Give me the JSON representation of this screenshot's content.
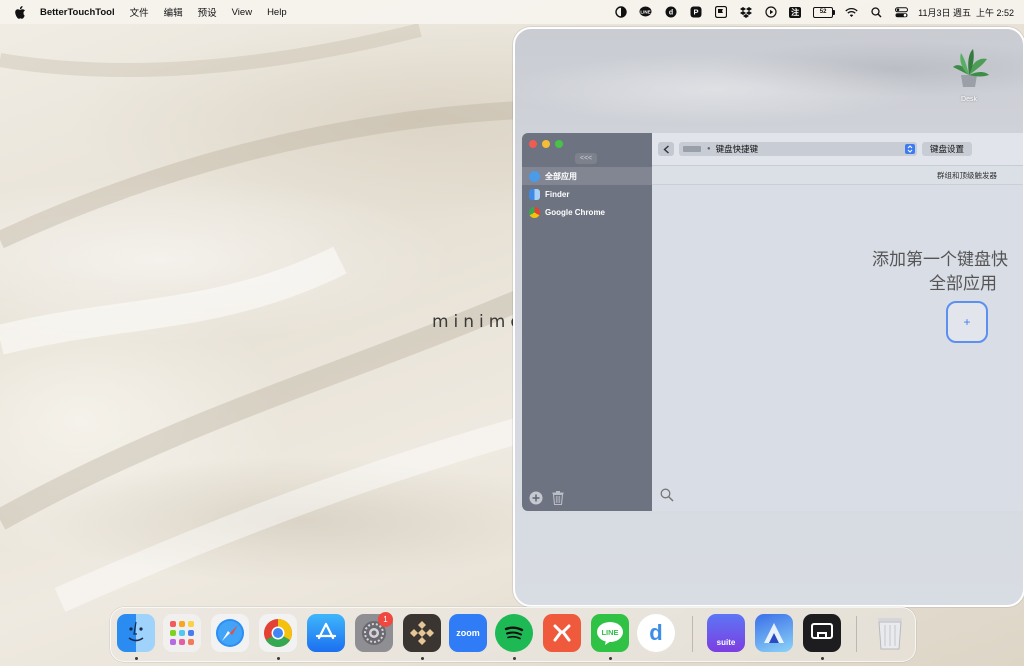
{
  "menubar": {
    "app_name": "BetterTouchTool",
    "menus": [
      "文件",
      "编辑",
      "预设",
      "View",
      "Help"
    ],
    "status_icons": [
      "contrast-icon",
      "line-icon",
      "d-app-icon",
      "p-app-icon",
      "flag-icon",
      "dropbox-icon",
      "play-icon"
    ],
    "input_method": "注",
    "battery": "52",
    "date": "11月3日 週五",
    "time": "上午 2:52"
  },
  "desktop": {
    "wallpaper_text": "minimo",
    "desk_icon_label": "Desk"
  },
  "btt": {
    "collapse_label": "<<<",
    "apps": [
      {
        "label": "全部应用",
        "color": "#4a9be8"
      },
      {
        "label": "Finder",
        "color": "#3f8ae6"
      },
      {
        "label": "Google Chrome",
        "color": "#e9c23a"
      }
    ],
    "trigger_type": "键盘快捷键",
    "settings_label": "键盘设置",
    "subbar_label": "群组和顶级触发器",
    "empty_title": "添加第一个键盘快",
    "empty_subtitle": "全部应用",
    "add_label": "+"
  },
  "dock": {
    "apps": [
      "Finder",
      "Launchpad",
      "Safari",
      "Google Chrome",
      "App Store",
      "System Settings",
      "BetterTouchTool",
      "Zoom",
      "Spotify",
      "Mango",
      "LINE",
      "Dayone",
      "Suite",
      "Artstudio",
      "BetterDisplay",
      "Trash"
    ],
    "settings_badge": "1",
    "zoom_label": "zoom",
    "suite_label": "suite",
    "d_label": "d",
    "line_label": "LINE"
  },
  "colors": {
    "accent": "#3d7cf0",
    "sidebar": "#6d7380"
  }
}
